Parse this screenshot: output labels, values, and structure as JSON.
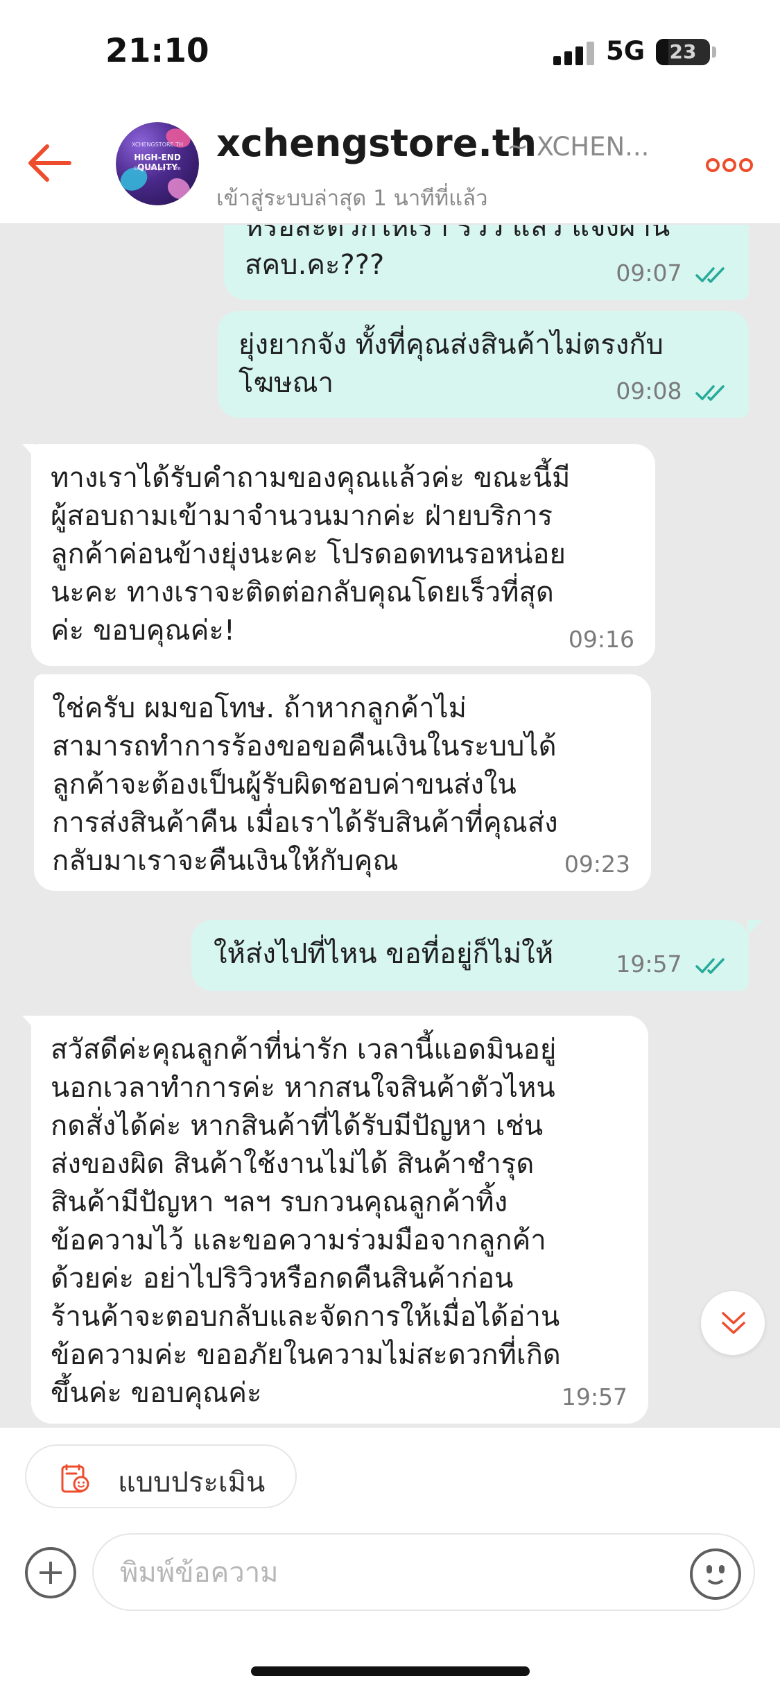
{
  "status_bar": {
    "time": "21:10",
    "network": "5G",
    "battery": "23"
  },
  "header": {
    "shop_name": "xchengstore.th",
    "shop_alias": "~ XCHEN...",
    "last_seen": "เข้าสู่ระบบล่าสุด 1 นาทีที่แล้ว",
    "avatar": {
      "small_text": "XCHENGSTORE.TH",
      "title": "HIGH-END QUALITY",
      "tagline": "Enjoy the joy of life"
    }
  },
  "messages": [
    {
      "direction": "out",
      "text": "หรือสะดวกให้เรา รีวิว แล้ว แจ้งผ่าน\nสคบ.คะ???",
      "time": "09:07",
      "read": true
    },
    {
      "direction": "out",
      "text": "ยุ่งยากจัง ทั้งที่คุณส่งสินค้าไม่ตรงกับ\nโฆษณา",
      "time": "09:08",
      "read": true
    },
    {
      "direction": "in",
      "text": "ทางเราได้รับคำถามของคุณแล้วค่ะ ขณะนี้มี\nผู้สอบถามเข้ามาจำนวนมากค่ะ ฝ่ายบริการ\nลูกค้าค่อนข้างยุ่งนะคะ โปรดอดทนรอหน่อย\nนะคะ ทางเราจะติดต่อกลับคุณโดยเร็วที่สุด\nค่ะ ขอบคุณค่ะ!",
      "time": "09:16"
    },
    {
      "direction": "in",
      "text": "ใช่ครับ ผมขอโทษ. ถ้าหากลูกค้าไม่\nสามารถทำการร้องขอขอคืนเงินในระบบได้\nลูกค้าจะต้องเป็นผู้รับผิดชอบค่าขนส่งใน\nการส่งสินค้าคืน เมื่อเราได้รับสินค้าที่คุณส่ง\nกลับมาเราจะคืนเงินให้กับคุณ",
      "time": "09:23"
    },
    {
      "direction": "out",
      "text": "ให้ส่งไปที่ไหน ขอที่อยู่ก็ไม่ให้",
      "time": "19:57",
      "read": true
    },
    {
      "direction": "in",
      "text": "สวัสดีค่ะคุณลูกค้าที่น่ารัก เวลานี้แอดมินอยู่\nนอกเวลาทำการค่ะ หากสนใจสินค้าตัวไหน\nกดสั่งได้ค่ะ หากสินค้าที่ได้รับมีปัญหา เช่น\nส่งของผิด สินค้าใช้งานไม่ได้ สินค้าชำรุด\nสินค้ามีปัญหา ฯลฯ รบกวนคุณลูกค้าทิ้ง\nข้อความไว้ และขอความร่วมมือจากลูกค้า\nด้วยค่ะ อย่าไปริวิวหรือกดคืนสินค้าก่อน\nร้านค้าจะตอบกลับและจัดการให้เมื่อได้อ่าน\nข้อความค่ะ ขออภัยในความไม่สะดวกที่เกิด\nขึ้นค่ะ ขอบคุณค่ะ",
      "time": "19:57"
    }
  ],
  "bottom": {
    "rating_label": "แบบประเมิน",
    "input_placeholder": "พิมพ์ข้อความ"
  },
  "colors": {
    "accent": "#ee4d2d",
    "outgoing_bubble": "#d7f6ef",
    "incoming_bubble": "#ffffff",
    "read_tick": "#26aa99",
    "background": "#e9e9e9"
  },
  "icons": {
    "back": "arrow-left-icon",
    "more": "more-dots-icon",
    "read": "double-check-icon",
    "scroll_down": "chevron-double-down-icon",
    "rating": "rating-form-icon",
    "add": "plus-circle-icon",
    "emoji": "smiley-icon"
  }
}
